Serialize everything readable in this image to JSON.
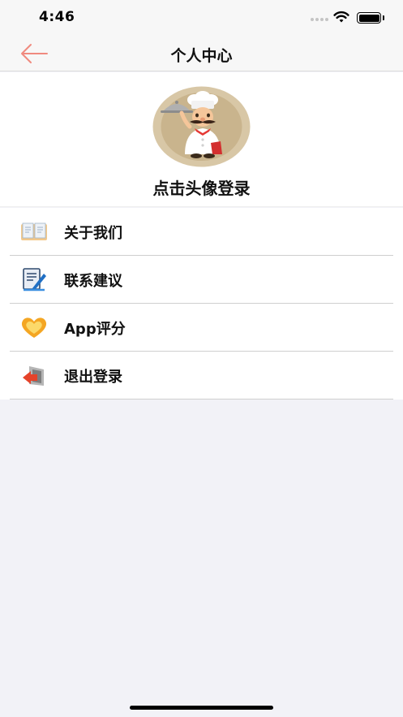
{
  "status_bar": {
    "time": "4:46"
  },
  "nav": {
    "title": "个人中心",
    "back_icon": "arrow-left-icon",
    "accent_color": "#f08a7f"
  },
  "profile": {
    "login_prompt": "点击头像登录"
  },
  "menu": {
    "items": [
      {
        "label": "关于我们",
        "icon": "book-icon"
      },
      {
        "label": "联系建议",
        "icon": "document-pen-icon"
      },
      {
        "label": "App评分",
        "icon": "heart-icon"
      },
      {
        "label": "退出登录",
        "icon": "exit-icon"
      }
    ]
  }
}
